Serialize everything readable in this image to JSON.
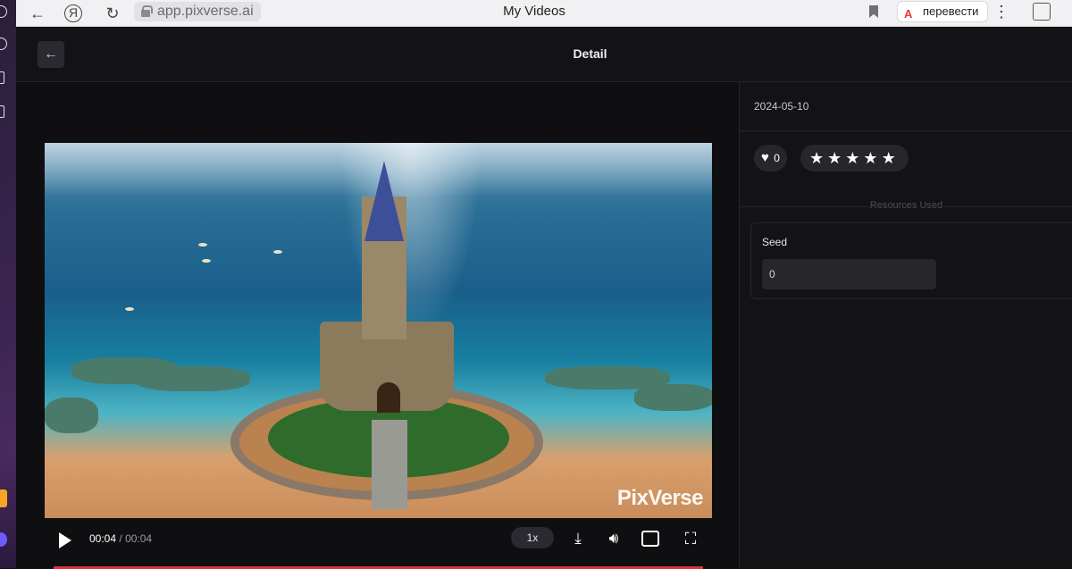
{
  "browser": {
    "url": "app.pixverse.ai",
    "tab_title": "My Videos",
    "translate_label": "перевести"
  },
  "header": {
    "title": "Detail"
  },
  "player": {
    "watermark": "PixVerse",
    "current_time": "00:04",
    "separator": "/",
    "duration": "00:04",
    "speed": "1x",
    "progress": 1.0,
    "accent_color": "#e0303c"
  },
  "details": {
    "date": "2024-05-10",
    "likes": "0",
    "rating_stars": 5,
    "resources_label": "Resources Used",
    "seed_label": "Seed",
    "seed_value": "0"
  },
  "icons": {
    "back": "arrow-left-icon",
    "heart": "heart-icon",
    "star": "star-icon",
    "play": "play-icon",
    "download": "download-icon",
    "volume": "volume-icon",
    "pip": "picture-in-picture-icon",
    "fullscreen": "fullscreen-icon"
  }
}
